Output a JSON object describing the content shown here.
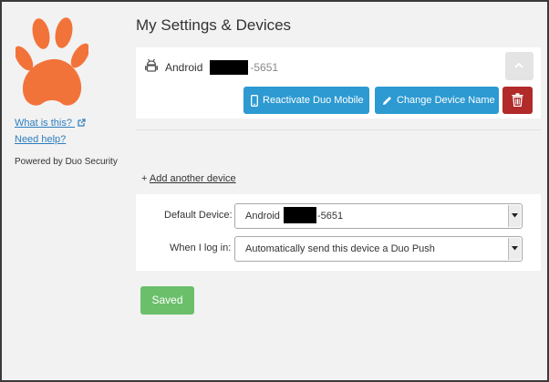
{
  "sidebar": {
    "logo": "paw-print-logo",
    "what_is_this": "What is this?",
    "need_help": "Need help?",
    "powered_by": "Powered by Duo Security"
  },
  "page": {
    "title": "My Settings & Devices"
  },
  "device": {
    "name": "Android",
    "phone_suffix": "-5651",
    "reactivate_label": "Reactivate Duo Mobile",
    "rename_label": "Change Device Name"
  },
  "add_device": {
    "plus": "+",
    "label": "Add another device"
  },
  "settings": {
    "default_device_label": "Default Device:",
    "default_device_name": "Android",
    "default_device_suffix": "-5651",
    "login_label": "When I log in:",
    "login_value": "Automatically send this device a Duo Push"
  },
  "actions": {
    "saved_label": "Saved"
  },
  "colors": {
    "accent_blue": "#2d9ad1",
    "delete_red": "#b12b2b",
    "saved_green": "#6bbf6b",
    "logo_orange": "#f2733a",
    "link_blue": "#2d7ebf"
  }
}
